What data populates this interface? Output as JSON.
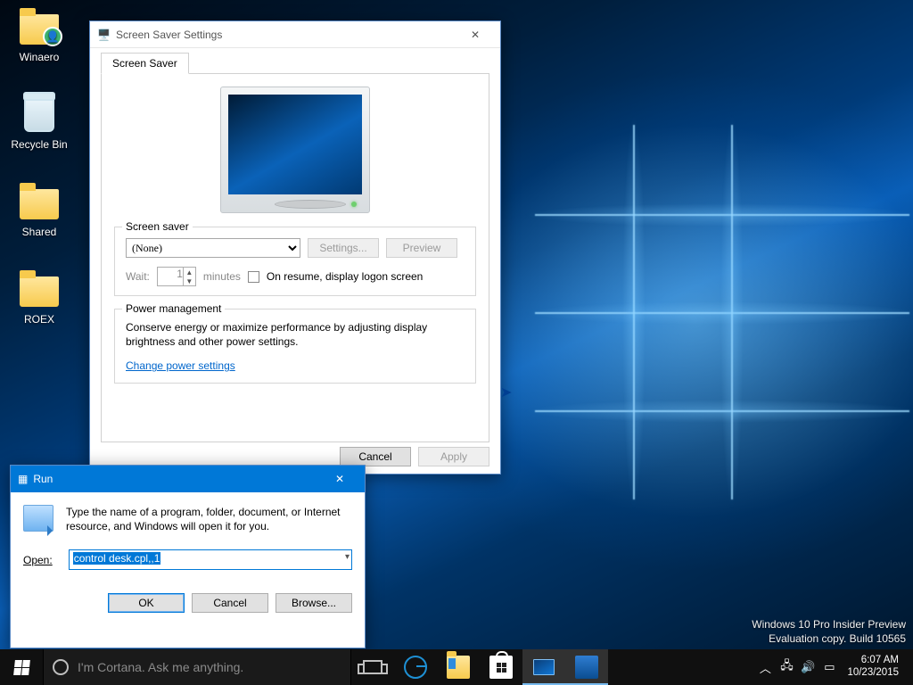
{
  "desktop_icons": {
    "winaero": "Winaero",
    "recycle": "Recycle Bin",
    "shared": "Shared",
    "roex": "ROEX"
  },
  "ss": {
    "title": "Screen Saver Settings",
    "tab": "Screen Saver",
    "group_saver": "Screen saver",
    "selected": "(None)",
    "settings_btn": "Settings...",
    "preview_btn": "Preview",
    "wait_label": "Wait:",
    "wait_value": "1",
    "minutes": "minutes",
    "resume_chk": "On resume, display logon screen",
    "group_power": "Power management",
    "power_desc": "Conserve energy or maximize performance by adjusting display brightness and other power settings.",
    "power_link": "Change power settings",
    "cancel": "Cancel",
    "apply": "Apply"
  },
  "run": {
    "title": "Run",
    "desc": "Type the name of a program, folder, document, or Internet resource, and Windows will open it for you.",
    "open_label": "Open:",
    "open_value": "control desk.cpl,,1",
    "ok": "OK",
    "cancel": "Cancel",
    "browse": "Browse..."
  },
  "watermark": {
    "l1": "Windows 10 Pro Insider Preview",
    "l2": "Evaluation copy. Build 10565"
  },
  "taskbar": {
    "cortana_placeholder": "I'm Cortana. Ask me anything."
  },
  "tray": {
    "time": "6:07 AM",
    "date": "10/23/2015"
  }
}
